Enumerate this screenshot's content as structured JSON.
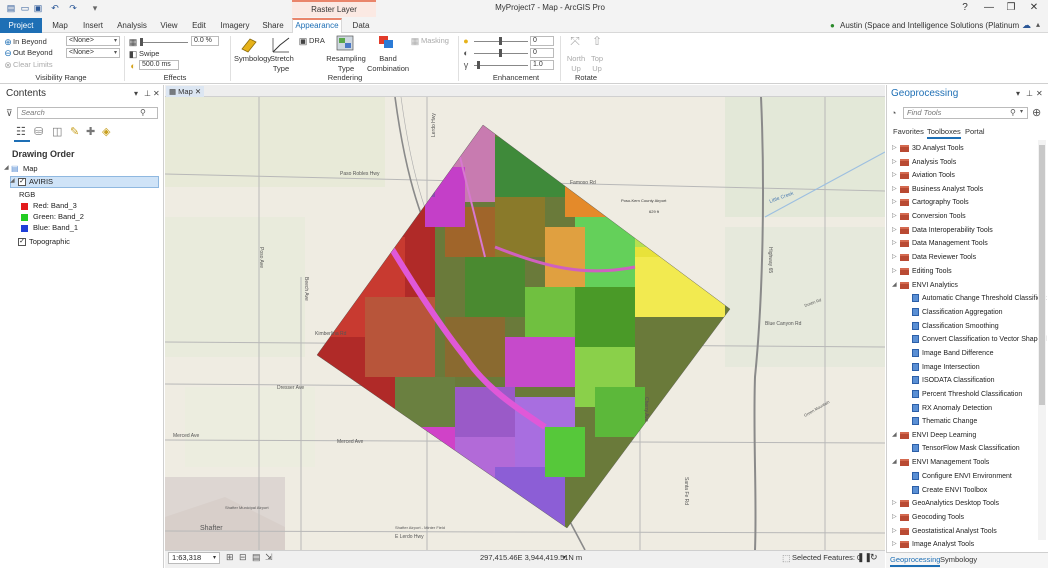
{
  "titlebar": {
    "context_label": "Raster Layer",
    "doc_title": "MyProject7 - Map - ArcGIS Pro",
    "help": "?",
    "minimize": "—",
    "restore": "❐",
    "close": "✕"
  },
  "tabs": [
    "Project",
    "Map",
    "Insert",
    "Analysis",
    "View",
    "Edit",
    "Imagery",
    "Share",
    "Appearance",
    "Data"
  ],
  "user": "Austin (Space and Intelligence Solutions (Platinum Partner))",
  "ribbon": {
    "visibility": {
      "in_beyond": "In Beyond",
      "out_beyond": "Out Beyond",
      "clear_limits": "Clear Limits",
      "none1": "<None>",
      "none2": "<None>",
      "group": "Visibility Range"
    },
    "effects": {
      "transparency": "0.0 %",
      "swipe": "Swipe",
      "flicker": "500.0 ms",
      "group": "Effects"
    },
    "rendering": {
      "symbology": "Symbology",
      "stretch_type": "Stretch Type",
      "dra": "DRA",
      "resampling_type": "Resampling Type",
      "band_combination": "Band Combination",
      "masking": "Masking",
      "group": "Rendering"
    },
    "enhancement": {
      "brightness": "0",
      "contrast": "0",
      "gamma": "1.0",
      "group": "Enhancement"
    },
    "rotate": {
      "north_up": "North Up",
      "top_up": "Top Up",
      "group": "Rotate"
    }
  },
  "contents": {
    "title": "Contents",
    "search_placeholder": "Search",
    "drawing_order": "Drawing Order",
    "map_label": "Map",
    "layer": "AVIRIS",
    "rgb": "RGB",
    "bands": [
      {
        "label": "Red:  Band_3",
        "color": "#e31a1c"
      },
      {
        "label": "Green: Band_2",
        "color": "#22cc22"
      },
      {
        "label": "Blue:  Band_1",
        "color": "#1f3fd8"
      }
    ],
    "basemap": "Topographic"
  },
  "map": {
    "tab_label": "Map",
    "labels": {
      "paso_robles": "Paso Robles Hwy",
      "lerdo": "Lerdo Hwy",
      "kimberlina": "Kimberlina Rd",
      "dresser": "Dresser Ave",
      "merced1": "Merced Ave",
      "merced2": "Merced Ave",
      "shafter": "Shafter",
      "shafter_airport": "Shafter Airport - Minter Field",
      "e_lerdo": "E Lerdo Hwy",
      "little_creek": "Little Creek",
      "poso_ave": "Poso Ave",
      "beech": "Beech Ave",
      "kern_airport": "Poso-Kern County Airport",
      "elev": "629 ft",
      "famoso": "Famoso Rd",
      "highway": "Highway 65",
      "blue_canyon": "Blue Canyon Rd",
      "santa_fe": "Santa Fe Rd",
      "shafter_mun": "Shafter Municipal Airport",
      "cherry": "Cherry Ave",
      "green_mountain": "Green Mountain",
      "dustin": "Dustin Rd"
    }
  },
  "status": {
    "scale": "1:63,318",
    "coords": "297,415.46E 3,944,419.51N m",
    "selected": "Selected Features: 0"
  },
  "geoprocessing": {
    "title": "Geoprocessing",
    "search_placeholder": "Find Tools",
    "tabs": [
      "Favorites",
      "Toolboxes",
      "Portal"
    ],
    "toolboxes": [
      "3D Analyst Tools",
      "Analysis Tools",
      "Aviation Tools",
      "Business Analyst Tools",
      "Cartography Tools",
      "Conversion Tools",
      "Data Interoperability Tools",
      "Data Management Tools",
      "Data Reviewer Tools",
      "Editing Tools"
    ],
    "envi_analytics": "ENVI Analytics",
    "envi_analytics_tools": [
      "Automatic Change Threshold Classificat",
      "Classification Aggregation",
      "Classification Smoothing",
      "Convert Classification to Vector Shapefil",
      "Image Band Difference",
      "Image Intersection",
      "ISODATA Classification",
      "Percent Threshold Classification",
      "RX Anomaly Detection",
      "Thematic Change"
    ],
    "envi_deep_learning": "ENVI Deep Learning",
    "envi_deep_learning_tools": [
      "TensorFlow Mask Classification"
    ],
    "envi_management": "ENVI Management Tools",
    "envi_management_tools": [
      "Configure ENVI Environment",
      "Create ENVI Toolbox"
    ],
    "more_toolboxes": [
      "GeoAnalytics Desktop Tools",
      "Geocoding Tools",
      "Geostatistical Analyst Tools",
      "Image Analyst Tools"
    ],
    "bottom_tabs": [
      "Geoprocessing",
      "Symbology"
    ]
  }
}
